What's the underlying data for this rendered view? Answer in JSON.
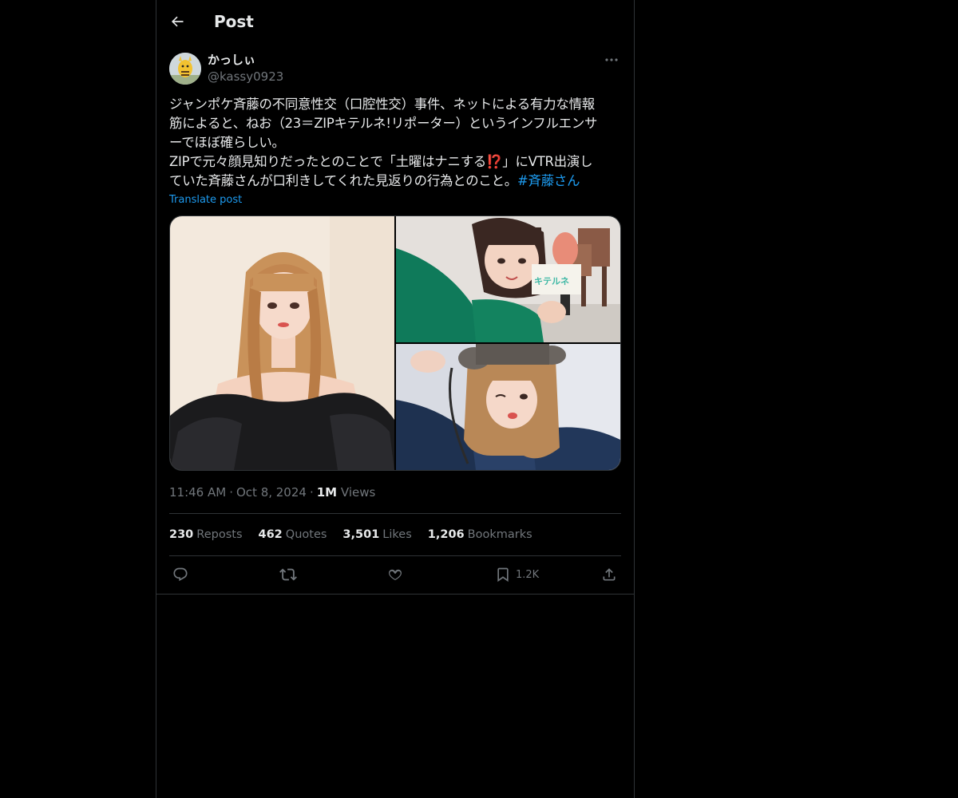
{
  "header": {
    "back_icon": "arrow-left-icon",
    "title": "Post"
  },
  "author": {
    "name": "かっしぃ",
    "handle": "@kassy0923",
    "more_icon": "more-dots-icon"
  },
  "tweet": {
    "lines": [
      "ジャンポケ斉藤の不同意性交（口腔性交）事件、ネットによる有力な情報",
      "筋によると、ねお（23＝ZIPキテルネ!リポーター）というインフルエンサ",
      "ーでほぼ確らしい。"
    ],
    "line4_before": "ZIPで元々顔見知りだったとのことで「土曜はナニする",
    "line4_emoji": "⁉️",
    "line4_after": "」にVTR出演し",
    "line5_text": "ていた斉藤さんが口利きしてくれた見返りの行為とのこと。",
    "hashtag": "#斉藤さん",
    "translate_label": "Translate post"
  },
  "media": {
    "photos": [
      "photo-portrait-black-dress",
      "photo-green-top-microphone",
      "photo-denim-jacket-selfie"
    ],
    "mic_flag_text": "キテルネ"
  },
  "meta": {
    "time": "11:46 AM",
    "separator": "·",
    "date": "Oct 8, 2024",
    "views_count": "1M",
    "views_label": "Views"
  },
  "stats": [
    {
      "count": "230",
      "label": "Reposts"
    },
    {
      "count": "462",
      "label": "Quotes"
    },
    {
      "count": "3,501",
      "label": "Likes"
    },
    {
      "count": "1,206",
      "label": "Bookmarks"
    }
  ],
  "actions": {
    "reply_icon": "reply-icon",
    "repost_icon": "repost-icon",
    "like_icon": "heart-icon",
    "bookmark_icon": "bookmark-icon",
    "bookmark_count": "1.2K",
    "share_icon": "share-icon"
  },
  "colors": {
    "background": "#000000",
    "text": "#e7e9ea",
    "secondary": "#71767b",
    "accent": "#1d9bf0",
    "border": "#2f3336"
  }
}
